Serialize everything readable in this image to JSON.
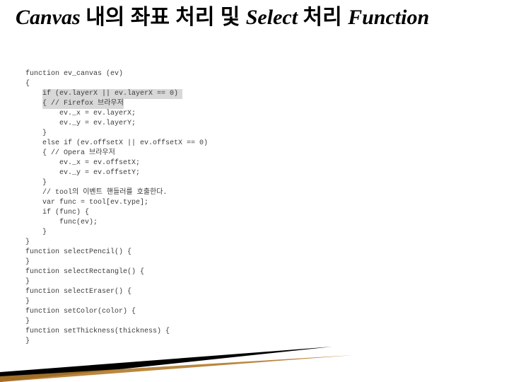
{
  "title_parts": {
    "p1": "Canvas ",
    "p2": "내의 좌표 처리 및 ",
    "p3": "Select ",
    "p4": "처리 ",
    "p5": "Function"
  },
  "code": {
    "l01": "function ev_canvas (ev)",
    "l02": "{",
    "l03a": "    ",
    "l03b": "if (ev.layerX || ev.layerX == 0) ",
    "l04a": "    ",
    "l04b": "{ // Firefox 브라우저",
    "l05": "        ev._x = ev.layerX;",
    "l06": "        ev._y = ev.layerY;",
    "l07": "    }",
    "l08": "    else if (ev.offsetX || ev.offsetX == 0)",
    "l09": "    { // Opera 브라우저",
    "l10": "        ev._x = ev.offsetX;",
    "l11": "        ev._y = ev.offsetY;",
    "l12": "    }",
    "l13": "    // tool의 이벤트 핸들러를 호출한다.",
    "l14": "    var func = tool[ev.type];",
    "l15": "    if (func) {",
    "l16": "        func(ev);",
    "l17": "    }",
    "l18": "}",
    "l19": "",
    "l20": "function selectPencil() {",
    "l21": "",
    "l22": "}",
    "l23": "function selectRectangle() {",
    "l24": "",
    "l25": "}",
    "l26": "function selectEraser() {",
    "l27": "",
    "l28": "}",
    "l29": "function setColor(color) {",
    "l30": "",
    "l31": "}",
    "l32": "function setThickness(thickness) {",
    "l33": "",
    "l34": "}"
  }
}
